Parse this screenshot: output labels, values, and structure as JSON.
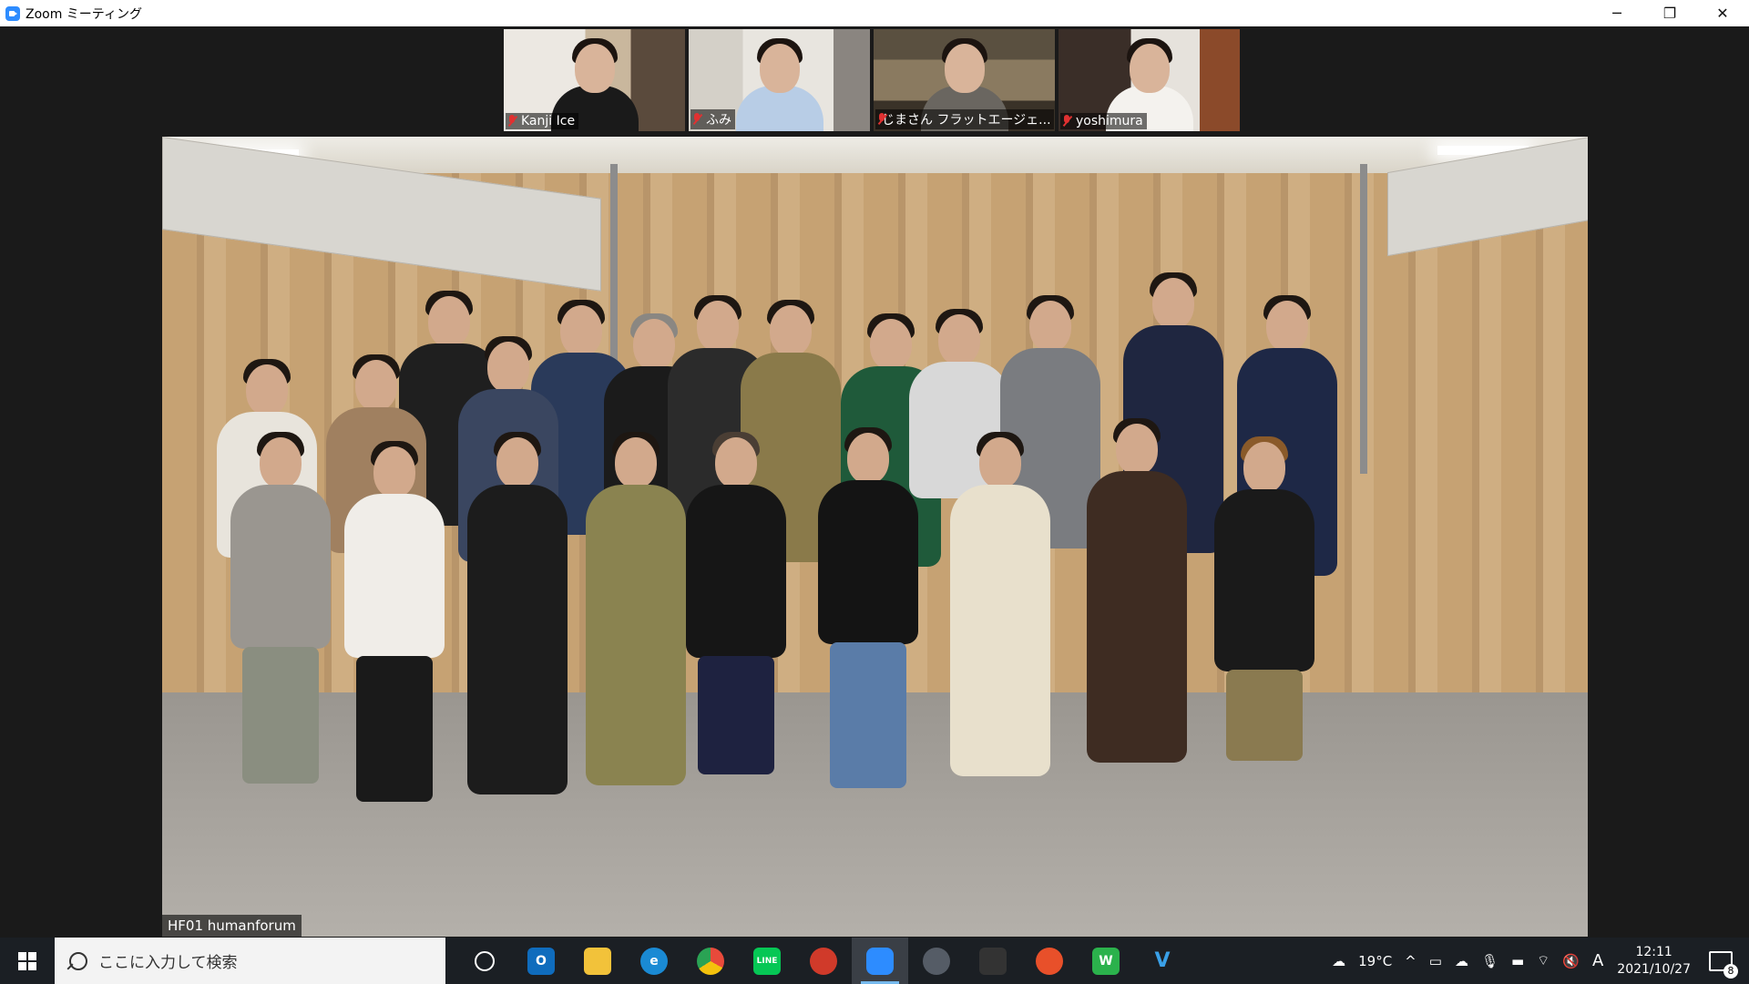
{
  "window": {
    "title": "Zoom ミーティング",
    "controls": {
      "minimize": "─",
      "restore": "❐",
      "close": "✕"
    }
  },
  "participants": [
    {
      "name": "Kanji Ice",
      "muted": true
    },
    {
      "name": "ふみ",
      "muted": true
    },
    {
      "name": "じまさん フラットエージェ...",
      "muted": true
    },
    {
      "name": "yoshimura",
      "muted": true
    }
  ],
  "main_video": {
    "caption": "HF01 humanforum"
  },
  "taskbar": {
    "search_placeholder": "ここに入力して検索",
    "apps": [
      {
        "name": "cortana",
        "label": ""
      },
      {
        "name": "outlook",
        "label": "O",
        "color": "#0f6cbd"
      },
      {
        "name": "file-explorer",
        "label": "",
        "color": "#f2c23a"
      },
      {
        "name": "edge",
        "label": "e",
        "color": "#1a8ad4"
      },
      {
        "name": "chrome",
        "label": "",
        "color": "#e84a3b"
      },
      {
        "name": "line",
        "label": "LINE",
        "color": "#06c755"
      },
      {
        "name": "app-red",
        "label": "",
        "color": "#d03a2a"
      },
      {
        "name": "zoom",
        "label": "",
        "color": "#2d8cff",
        "active": true
      },
      {
        "name": "davinci",
        "label": "",
        "color": "#555c66"
      },
      {
        "name": "app-dark",
        "label": "",
        "color": "#333"
      },
      {
        "name": "app-orange",
        "label": "",
        "color": "#e8502a"
      },
      {
        "name": "app-w",
        "label": "W",
        "color": "#2bb24c"
      },
      {
        "name": "app-v",
        "label": "V",
        "color": "#3aa0e8"
      }
    ],
    "weather": "19°C",
    "ime": "A",
    "time": "12:11",
    "date": "2021/10/27",
    "notification_count": "8"
  }
}
